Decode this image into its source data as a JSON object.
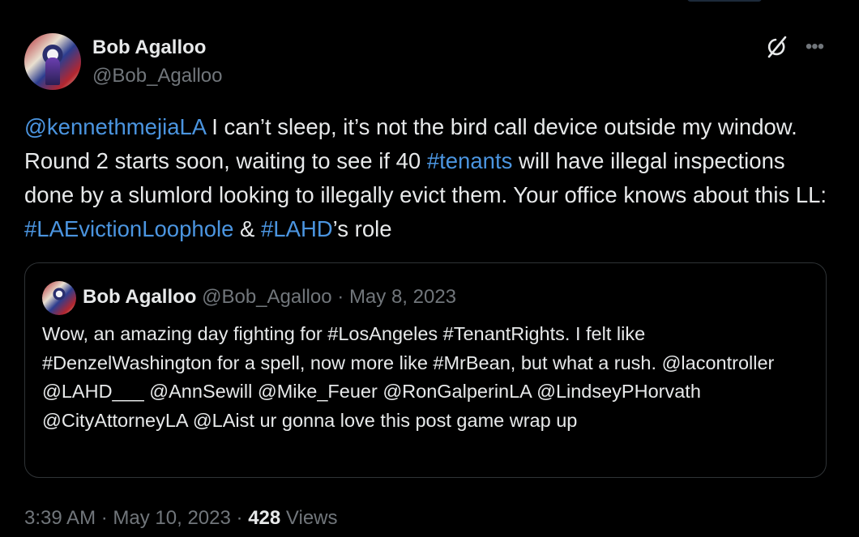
{
  "author": {
    "name": "Bob Agalloo",
    "handle": "@Bob_Agalloo"
  },
  "icons": {
    "grok": "grok-icon",
    "more": "more-icon"
  },
  "tweet": {
    "parts": [
      {
        "text": "@kennethmejiaLA",
        "link": true
      },
      {
        "text": " I can’t sleep, it’s not the bird call device outside my window. Round 2 starts soon, waiting to see if 40 ",
        "link": false
      },
      {
        "text": "#tenants",
        "link": true
      },
      {
        "text": " will have illegal inspections done by a slumlord looking to illegally evict them. Your office knows about this LL: ",
        "link": false
      },
      {
        "text": "#LAEvictionLoophole",
        "link": true
      },
      {
        "text": " & ",
        "link": false
      },
      {
        "text": "#LAHD",
        "link": true
      },
      {
        "text": "’s role",
        "link": false
      }
    ]
  },
  "quote": {
    "name": "Bob Agalloo",
    "handle": "@Bob_Agalloo",
    "separator": "·",
    "date": "May 8, 2023",
    "text": "Wow, an amazing day fighting for #LosAngeles #TenantRights. I felt like #DenzelWashington for a spell, now more like #MrBean, but what a rush. @lacontroller @LAHD___ @AnnSewill @Mike_Feuer @RonGalperinLA @LindseyPHorvath @CityAttorneyLA @LAist ur gonna love this post game wrap up"
  },
  "footer": {
    "time": "3:39 AM",
    "separator": "·",
    "date": "May 10, 2023",
    "views_count": "428",
    "views_label": "Views"
  },
  "colors": {
    "background": "#000000",
    "text": "#e7e9ea",
    "muted": "#71767b",
    "link": "#4b95e0",
    "border": "#2f3336"
  }
}
